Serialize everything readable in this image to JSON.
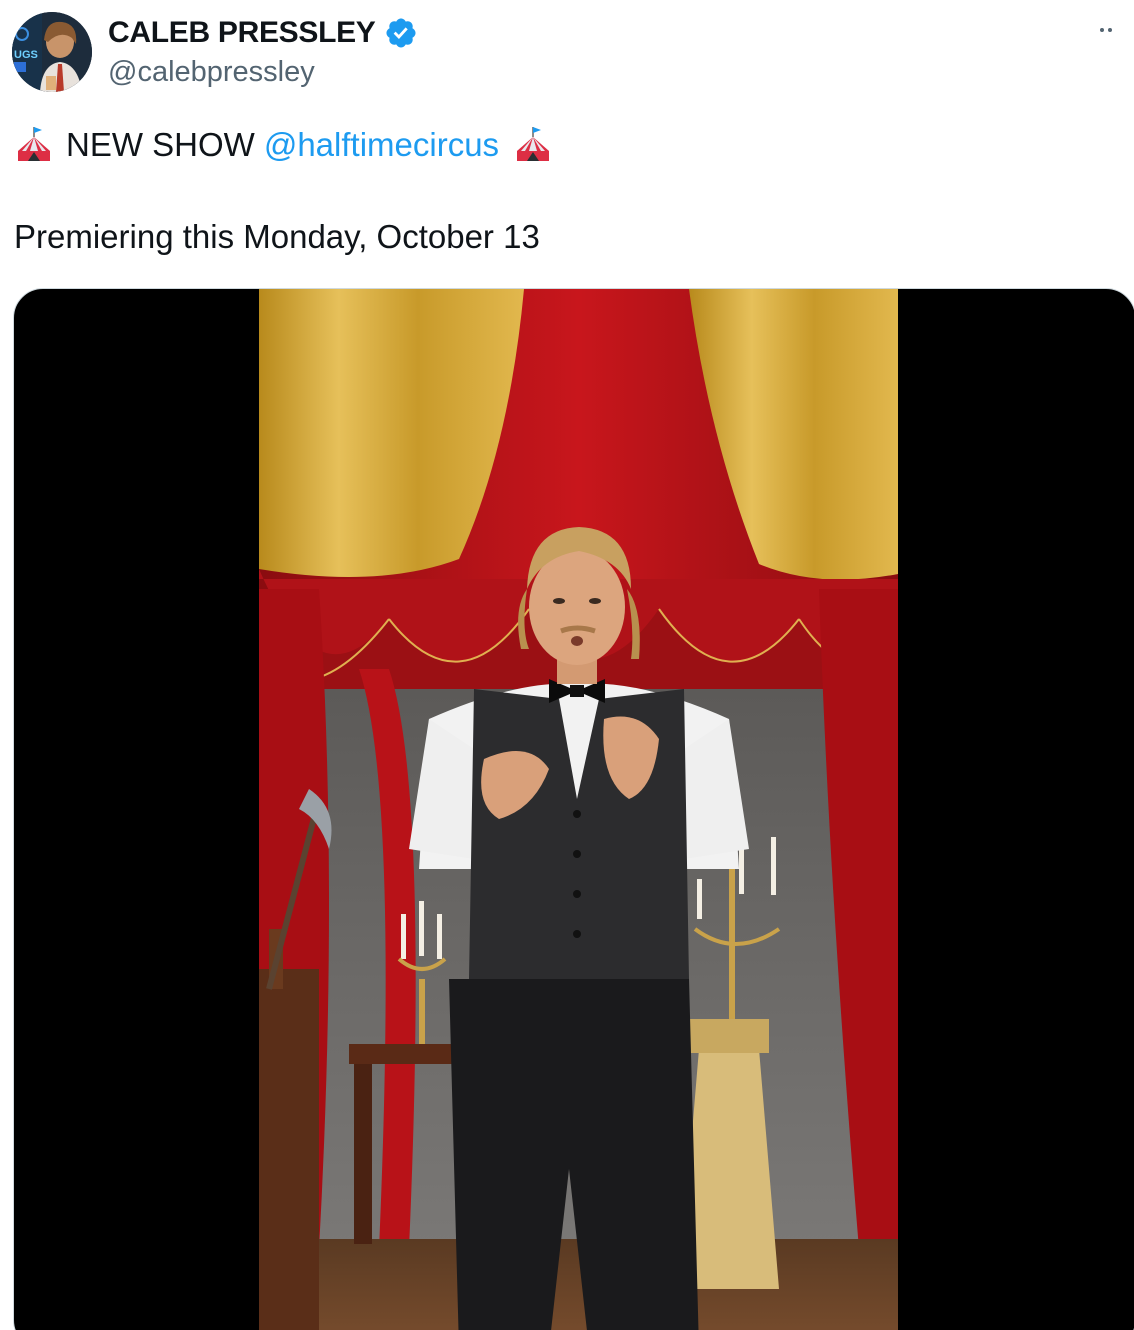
{
  "author": {
    "display_name": "CALEB PRESSLEY",
    "handle": "@calebpressley",
    "verified": true,
    "verified_badge_color": "#1d9bf0"
  },
  "tweet": {
    "line1_emoji": "circus-tent",
    "line1_text": "NEW SHOW",
    "mention": "@halftimecircus",
    "line2_text": "Premiering this Monday, October 13"
  },
  "media": {
    "type": "video",
    "description_icon": "video-thumbnail"
  },
  "colors": {
    "link": "#1d9bf0",
    "text": "#0f1419",
    "secondary": "#536471",
    "border": "#cfd9de"
  }
}
